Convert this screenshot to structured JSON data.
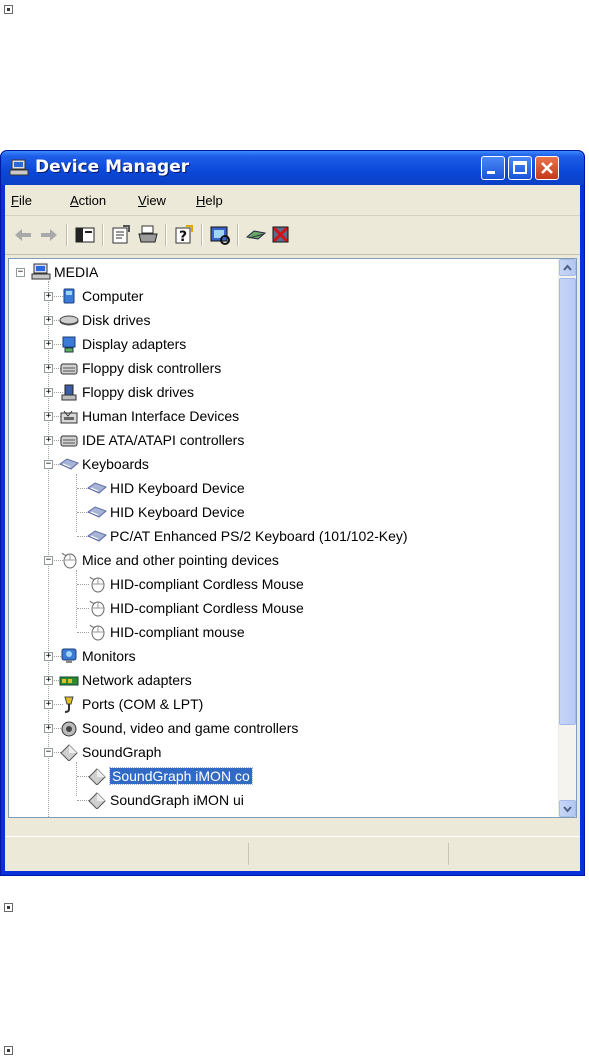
{
  "window": {
    "title": "Device Manager"
  },
  "menu": [
    {
      "label": "File",
      "ul": "F",
      "rest": "ile"
    },
    {
      "label": "Action",
      "ul": "A",
      "rest": "ction"
    },
    {
      "label": "View",
      "ul": "V",
      "rest": "iew"
    },
    {
      "label": "Help",
      "ul": "H",
      "rest": "elp"
    }
  ],
  "toolbar": [
    "back-icon",
    "forward-icon",
    "show-hide-console-tree-icon",
    "properties-icon",
    "print-icon",
    "help-icon",
    "scan-hardware-icon",
    "update-driver-icon",
    "uninstall-icon"
  ],
  "tree": {
    "root": "MEDIA",
    "nodes": [
      {
        "label": "Computer",
        "icon": "computer-icon"
      },
      {
        "label": "Disk drives",
        "icon": "disk-drive-icon"
      },
      {
        "label": "Display adapters",
        "icon": "display-adapter-icon"
      },
      {
        "label": "Floppy disk controllers",
        "icon": "controller-icon"
      },
      {
        "label": "Floppy disk drives",
        "icon": "floppy-drive-icon"
      },
      {
        "label": "Human Interface Devices",
        "icon": "hid-icon"
      },
      {
        "label": "IDE ATA/ATAPI controllers",
        "icon": "controller-icon"
      },
      {
        "label": "Keyboards",
        "icon": "keyboard-icon",
        "expanded": true,
        "children": [
          "HID Keyboard Device",
          "HID Keyboard Device",
          "PC/AT Enhanced PS/2 Keyboard (101/102-Key)"
        ]
      },
      {
        "label": "Mice and other pointing devices",
        "icon": "mouse-icon",
        "expanded": true,
        "children": [
          "HID-compliant Cordless Mouse",
          "HID-compliant Cordless Mouse",
          "HID-compliant mouse"
        ]
      },
      {
        "label": "Monitors",
        "icon": "monitor-icon"
      },
      {
        "label": "Network adapters",
        "icon": "network-adapter-icon"
      },
      {
        "label": "Ports (COM & LPT)",
        "icon": "port-icon"
      },
      {
        "label": "Sound, video and game controllers",
        "icon": "sound-icon"
      },
      {
        "label": "SoundGraph",
        "icon": "soundgraph-icon",
        "expanded": true,
        "children": [
          "SoundGraph iMON co",
          "SoundGraph iMON ui"
        ]
      }
    ],
    "selected": "SoundGraph iMON co"
  },
  "colors": {
    "title_bar": "#0a48d8",
    "selection": "#316ac5",
    "client": "#ece9d8"
  }
}
